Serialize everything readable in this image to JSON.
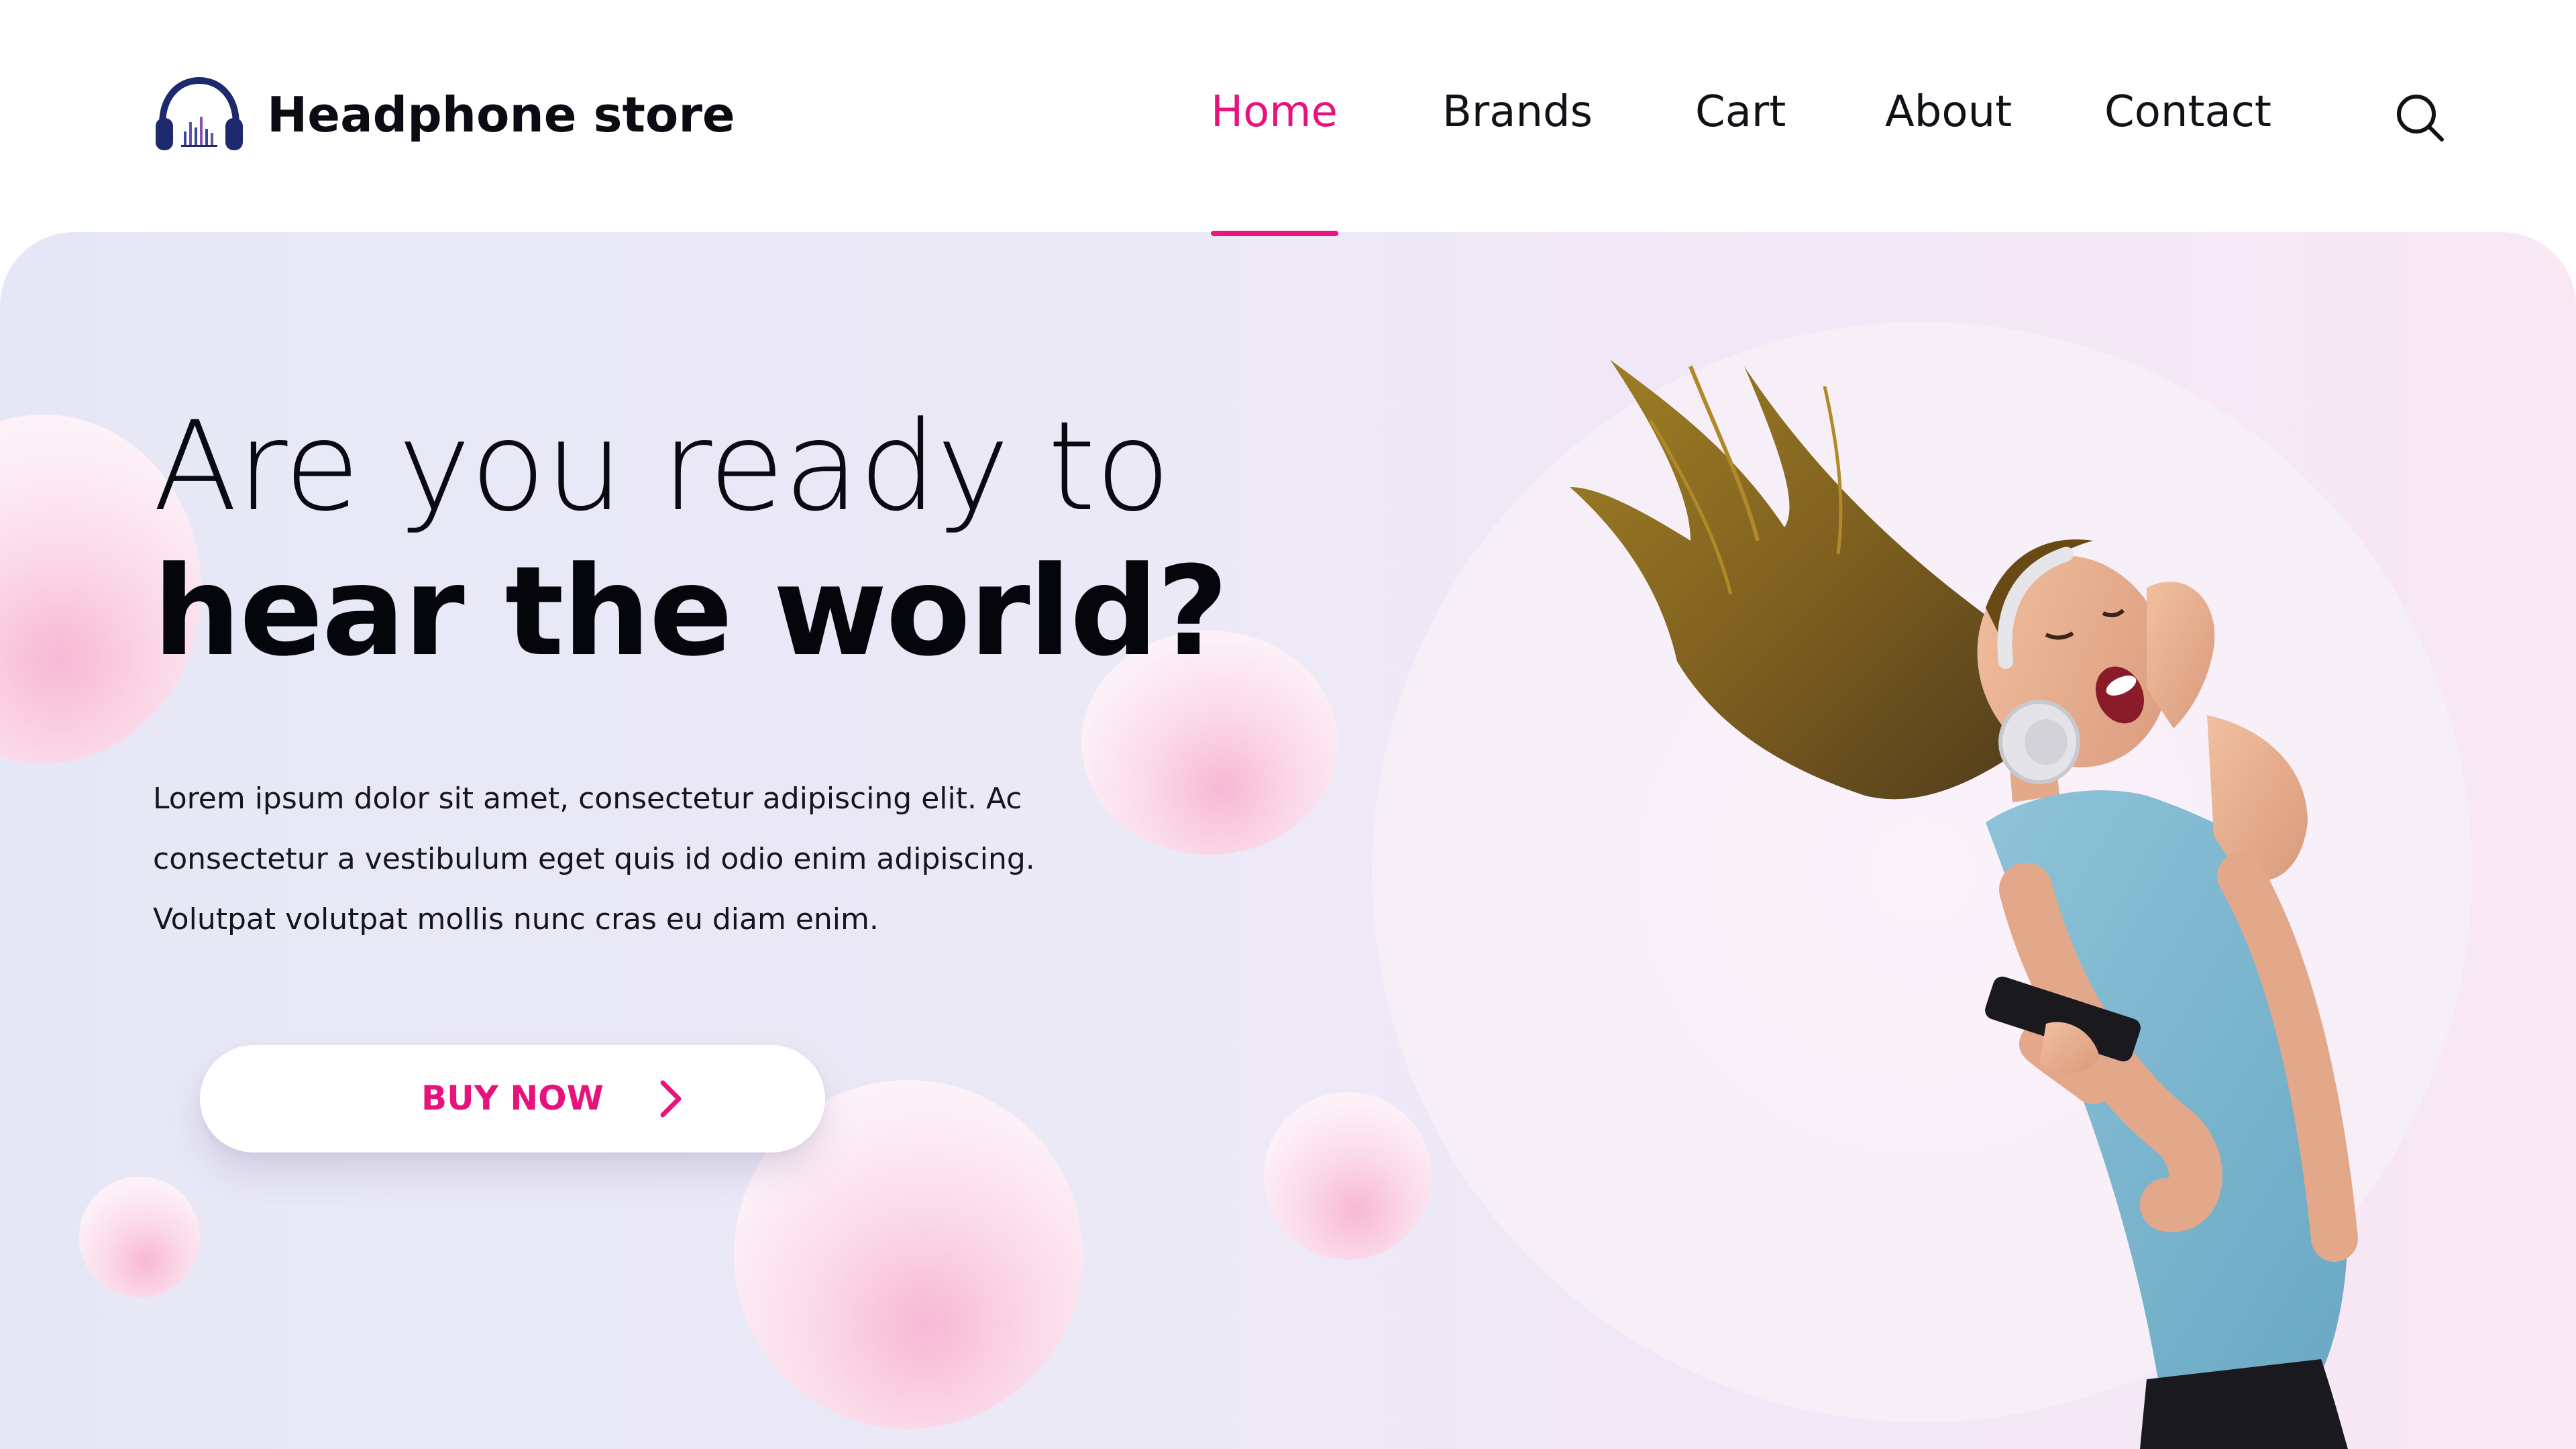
{
  "brand": {
    "name": "Headphone store",
    "logo_icon": "headphones-equalizer-icon",
    "logo_color": "#1f2a6e"
  },
  "nav": {
    "items": [
      {
        "label": "Home",
        "active": true
      },
      {
        "label": "Brands",
        "active": false
      },
      {
        "label": "Cart",
        "active": false
      },
      {
        "label": "About",
        "active": false
      },
      {
        "label": "Contact",
        "active": false
      }
    ],
    "active_color": "#e8127c",
    "search_icon": "search-icon"
  },
  "hero": {
    "headline_line1": "Are you ready to",
    "headline_line2": "hear the world?",
    "body_line1": "Lorem ipsum dolor sit amet, consectetur adipiscing elit. Ac",
    "body_line2": "consectetur a vestibulum eget quis id odio enim adipiscing.",
    "body_line3": "Volutpat volutpat mollis nunc cras eu diam enim.",
    "cta_label": "BUY NOW",
    "cta_icon": "chevron-right-icon",
    "image": "woman-listening-to-headphones"
  }
}
